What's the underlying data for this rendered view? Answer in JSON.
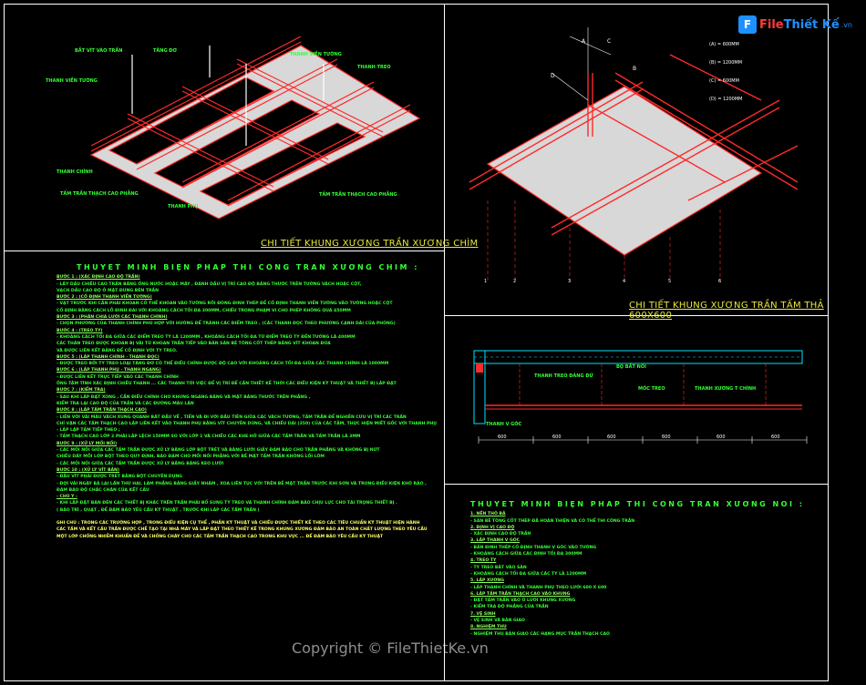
{
  "logo": {
    "mark": "F",
    "name_part1": "File",
    "name_part2": "Thiết Kế",
    "suffix": ".vn"
  },
  "watermark": "Copyright © FileThietKe.vn",
  "drawing1": {
    "title": "CHI TIẾT KHUNG XƯƠNG TRẦN XƯƠNG CHÌM",
    "labels": [
      "BẮT VÍT VÀO TRẦN",
      "TĂNG ĐƠ",
      "THANH VIỀN TƯỜNG",
      "THANH TREO",
      "THANH VIỀN TƯỜNG",
      "THANH CHÍNH",
      "TẤM TRẦN THẠCH CAO PHẲNG",
      "THANH PHỤ",
      "TẤM TRẦN THẠCH CAO PHẲNG"
    ]
  },
  "drawing2": {
    "title": "CHI TIẾT KHUNG XƯƠNG TRẦN TẤM THẢ 600X600",
    "axis_letters": [
      "A",
      "B",
      "C",
      "D"
    ],
    "legend": [
      "(A) = 600MM",
      "(B) = 1200MM",
      "(C) = 600MM",
      "(D) = 1200MM"
    ],
    "grid_numbers": [
      "1",
      "2",
      "3",
      "4",
      "5",
      "6"
    ]
  },
  "section": {
    "labels": [
      "THANH TREO ĐẢNG ĐỨ",
      "BỘ BẮT NỐI",
      "MÓC TREO",
      "THANH XƯƠNG T CHÍNH",
      "THANH V GÓC"
    ],
    "dims": [
      "600",
      "600",
      "600",
      "600",
      "600",
      "600"
    ]
  },
  "notes_left": {
    "heading": "THUYẾT MINH BIỆN PHÁP THI CÔNG TRẦN XƯƠNG CHÌM :",
    "lines": [
      {
        "t": "BƯỚC 1 : (XÁC ĐỊNH CAO ĐỘ TRẦN)",
        "s": "step"
      },
      {
        "t": "- LẤY DẤU CHIỀU CAO TRẦN BẰNG ỐNG NƯỚC HOẶC MÁY , ĐÁNH DẤU VỊ TRÍ CAO ĐỘ BẰNG THƯỚC TRÊN TƯỜNG VÁCH HOẶC CỘT,",
        "s": ""
      },
      {
        "t": "VẠCH DẤU CAO ĐỘ Ở MẶT ĐỨNG BÊN TRẦN",
        "s": ""
      },
      {
        "t": "BƯỚC 2 : (CỐ ĐỊNH THANH VIỀN TƯỜNG)",
        "s": "step"
      },
      {
        "t": "- VẠT TRƯỚC KHI CẦN PHẢI KHOAN CỐ THẾ KHOAN VÀO TƯỜNG RỒI ĐÓNG ĐINH THÉP ĐỂ CỐ ĐỊNH THANH VIỀN TƯỜNG VÀO TƯỜNG HOẶC CỘT",
        "s": ""
      },
      {
        "t": "CỐ ĐỊNH BẰNG CÁCH LỖ ĐINH ĐAI VỚI KHOẢNG CÁCH TỐI ĐA 300MM, CHIỀU TRONG PHẠM VI CHO PHÉP KHÔNG QUÁ 450MM",
        "s": ""
      },
      {
        "t": "BƯỚC 3 : (PHÂN CHIA LƯỚI CÁC THANH CHÍNH)",
        "s": "step"
      },
      {
        "t": "- CHỌN PHƯƠNG CỦA THANH CHÍNH PHÙ HỢP VỚI HƯỚNG ĐỂ TRÁNH CÁC ĐIỂM TREO , (CÁC THANH ĐỌC THEO PHƯƠNG CẠNH DÀI CỦA PHÒNG)",
        "s": ""
      },
      {
        "t": "BƯỚC 4 : (TREO TY)",
        "s": "step"
      },
      {
        "t": "- KHOẢNG CÁCH TỐI ĐA GIỮA CÁC ĐIỂM TREO TY LÀ 1200MM , KHOẢNG CÁCH TỐI ĐA TỪ ĐIỂM TREO TY ĐẾN TƯỜNG LÀ 400MM",
        "s": ""
      },
      {
        "t": "CÁC THÀN TREO ĐƯỢC KHOAN BỊ VÀI TỪ KHOAN TRẦN TIẾP VÀO BẢN SÀN BÊ TÔNG CỐT THÉP BẰNG VÍT KHOAN ĐỨA",
        "s": ""
      },
      {
        "t": "VÀ ĐƯỢC LIÊN KẾT BẰNG ĐỂ CỐ ĐỊNH VỚI TY TREO.",
        "s": ""
      },
      {
        "t": "BƯỚC 5 : (LẮP THANH CHÍNH - THANH ĐỌC)",
        "s": "step"
      },
      {
        "t": "- ĐƯỢC TREO BỞI TY TREO LOẠI TĂNG ĐƠ CÓ THỂ ĐIỀU CHỈNH ĐƯỢC ĐỘ CAO VỚI KHOẢNG CÁCH TỐI ĐA GIỮA CÁC THANH CHÍNH LÀ 1000MM",
        "s": ""
      },
      {
        "t": "BƯỚC 6 : (LẮP THANH PHỤ - THANH NGANG)",
        "s": "step"
      },
      {
        "t": "- ĐƯỢC LIÊN KẾT TRỰC TIẾP VÀO CÁC THANH CHÍNH",
        "s": ""
      },
      {
        "t": "ỐNG TÂM TĨNH XÁC ĐỊNH CHIỀU THANH ... CÁC THANH TỚI VIỆC ĐỂ VỊ TRÍ ĐỂ CẦN THIẾT KẾ THỜI CÁC ĐIỀU KIỆN KỸ THUẬT VÀ THIẾT BỊ LẮP ĐẶT",
        "s": ""
      },
      {
        "t": "BƯỚC 7 : (KIỂM TRA)",
        "s": "step"
      },
      {
        "t": "- SAU KHI LẮP ĐẶT XONG , CẦN ĐIỀU CHỈNH CHO KHUNG NGANG BẰNG VÀ MẶT BẰNG THƯỚC TRÊN PHẲNG ,",
        "s": ""
      },
      {
        "t": "KIỂM TRA LẠI CAO ĐỘ CỦA TRẦN VÀ CÁC ĐƯỜNG MÀU LĂN",
        "s": ""
      },
      {
        "t": "BƯỚC 8 : (LẮP TẤM TRẦN THẠCH CAO)",
        "s": "step"
      },
      {
        "t": "- LIÊN VỚI VÀI MÀU VÁCH XUNG QUANH BẮT ĐẦU VỀ , TIẾN VÀ ĐI VỚI ĐẦU TIÊN GIỮA CÁC VÁCH TƯỜNG, TẤM TRẦN ĐỂ NGHIÊN CỨU VỊ TRÍ CÁC TRẦN",
        "s": ""
      },
      {
        "t": "CHỈ VẬN CÁC TẤM THẠCH CAO LẮP LIÊN KẾT VÀO THANH PHỤ BẰNG VÍT CHUYÊN DÙNG, VÀ CHIỀU DÀI (350) CỦA CÁC TẤM, THỰC HIỆN MIẾT GỐC VỚI THANH PHỤ",
        "s": ""
      },
      {
        "t": "- LẮP LẶP TẤM TIẾP THEO ;",
        "s": ""
      },
      {
        "t": "- TẤM THẠCH CAO LỚP 2 PHẢI LẮP LỆCH 150MM SO VỚI LỚP 1 VÀ CHIỀU CÁC KHE HỞ GIỮA CÁC TẤM TRẦN VÀ TẤM TRẦN LÀ 3MM",
        "s": ""
      },
      {
        "t": "BƯỚC 9 : (XỬ LÝ MỐI NỐI)",
        "s": "step"
      },
      {
        "t": "- CÁC MỐI NỐI GIỮA CÁC TẤM TRẦN ĐƯỢC XỬ LÝ BẰNG LỚP BỘT TRÉT VÀ BĂNG LƯỚI GIẤY ĐẢM BẢO CHO TRẦN PHẲNG VÀ KHÔNG BỊ NỨT",
        "s": ""
      },
      {
        "t": "CHIỀU DÀY MỖI LỚP BỘT THEO QUY ĐỊNH, BẢO ĐẢM CHO MỐI NỐI PHẲNG VỚI BỀ MẶT TẤM TRẦN KHÔNG LỒI LÕM",
        "s": ""
      },
      {
        "t": "- CÁC MỐI NỐI GIỮA CÁC TẤM TRẦN ĐƯỢC XỬ LÝ BẰNG BĂNG KEO LƯỚI",
        "s": ""
      },
      {
        "t": "BƯỚC 10 : (XỬ LÝ VÍT BẮN)",
        "s": "step"
      },
      {
        "t": "- ĐẦU VÍT PHẢI ĐƯỢC TRÉT BẰNG BỘT CHUYÊN DỤNG",
        "s": ""
      },
      {
        "t": "- ĐỢI VÀI NGÀY BẢ LẠI LẦN THỨ HAI, LÀM PHẲNG BẰNG GIẤY NHÁM , XOA LIÊN TỤC VỚI TRÊN BỀ MẶT TRẦN TRƯỚC KHI SƠN VÀ TRONG ĐIỀU KIỆN KHÔ RÁO ,",
        "s": ""
      },
      {
        "t": "ĐẢM BẢO ĐỘ CHẮC CHẮN CỦA KẾT CẤU",
        "s": ""
      },
      {
        "t": "- CHÚ Ý :",
        "s": "step"
      },
      {
        "t": "- KHI LẮP ĐẶT BẢN ĐÈN CÁC THIẾT BỊ KHÁC TRÊN TRẦN PHẢI BỔ SUNG TY TREO VÀ THANH CHÍNH ĐẢM BẢO CHỊU LỰC CHO TẢI TRỌNG THIẾT BỊ .",
        "s": ""
      },
      {
        "t": "( BẢO TRÌ , QUẠT , ĐỂ ĐẢM BẢO YÊU CẦU KỸ THUẬT , TRƯỚC KHI LẮP CÁC TẤM TRẦN )",
        "s": ""
      },
      {
        "t": "",
        "s": ""
      },
      {
        "t": "GHI CHÚ : TRONG CÁC TRƯỜNG HỢP , TRONG ĐIỀU KIỆN CỤ THỂ , PHẦN KỸ THUẬT VÀ CHIỀU ĐƯỢC THIẾT KẾ THEO CÁC TIÊU CHUẨN KỸ THUẬT HIỆN HÀNH",
        "s": "gc"
      },
      {
        "t": "CÁC TẤM VÀ KẾT CẤU TRẦN ĐƯỢC CHẾ TẠO TẠI NHÀ MÁY VÀ LẮP ĐẶT THEO THIẾT KẾ TRONG KHUNG XƯƠNG ĐẢM BẢO AN TOÀN CHẤT LƯỢNG THEO YÊU CẦU",
        "s": "gc"
      },
      {
        "t": "MỘT LỚP CHỐNG NHIỄM KHUẨN ĐỂ VÀ CHỐNG CHÁY CHO CÁC TẤM TRẦN THẠCH CAO TRONG KHU VỰC ... ĐỂ ĐẢM BẢO YÊU CẦU KỸ THUẬT",
        "s": "gc"
      }
    ]
  },
  "notes_right": {
    "heading": "THUYẾT MINH BIỆN PHÁP THI CÔNG TRẦN XƯƠNG NỔI :",
    "lines": [
      {
        "t": "1. NỀN THÔ BÃ",
        "s": "step"
      },
      {
        "t": "- SÀN BÊ TÔNG CỐT THÉP ĐÃ HOÀN THIỆN VÀ CÓ THỂ THI CÔNG TRẦN",
        "s": ""
      },
      {
        "t": "2. ĐỊNH VỊ CAO ĐỘ",
        "s": "step"
      },
      {
        "t": "- XÁC ĐỊNH CAO ĐỘ TRẦN",
        "s": ""
      },
      {
        "t": "3. LẮP THANH V GÓC",
        "s": "step"
      },
      {
        "t": "- BẮN ĐINH THÉP CỐ ĐỊNH THANH V GÓC VÀO TƯỜNG",
        "s": ""
      },
      {
        "t": "- KHOẢNG CÁCH GIỮA CÁC ĐINH TỐI ĐA 300MM",
        "s": ""
      },
      {
        "t": "4. TREO TY",
        "s": "step"
      },
      {
        "t": "- TY TREO BẮT VÀO SÀN",
        "s": ""
      },
      {
        "t": "- KHOẢNG CÁCH TỐI ĐA GIỮA CÁC TY LÀ 1200MM",
        "s": ""
      },
      {
        "t": "5. LẮP XƯƠNG",
        "s": "step"
      },
      {
        "t": "- LẮP THANH CHÍNH VÀ THANH PHỤ THEO LƯỚI 600 X 600",
        "s": ""
      },
      {
        "t": "6. LẮP TẤM TRẦN THẠCH CAO VÀO KHUNG",
        "s": "step"
      },
      {
        "t": "- ĐẶT TẤM TRẦN VÀO Ô LƯỚI KHUNG XƯƠNG",
        "s": ""
      },
      {
        "t": "- KIỂM TRA ĐỘ PHẲNG CỦA TRẦN",
        "s": ""
      },
      {
        "t": "7. VỆ SINH",
        "s": "step"
      },
      {
        "t": "- VỆ SINH VÀ BÀN GIAO",
        "s": ""
      },
      {
        "t": "8. NGHIỆM THU",
        "s": "step"
      },
      {
        "t": "- NGHIỆM THU BÀN GIAO CÁC HẠNG MỤC TRẦN THẠCH CAO",
        "s": ""
      }
    ]
  },
  "colors": {
    "frame": "#ffffff",
    "drawing": "#ff2a2a",
    "text": "#33ff33",
    "title": "#e8e840",
    "logo": "#1e90ff"
  }
}
